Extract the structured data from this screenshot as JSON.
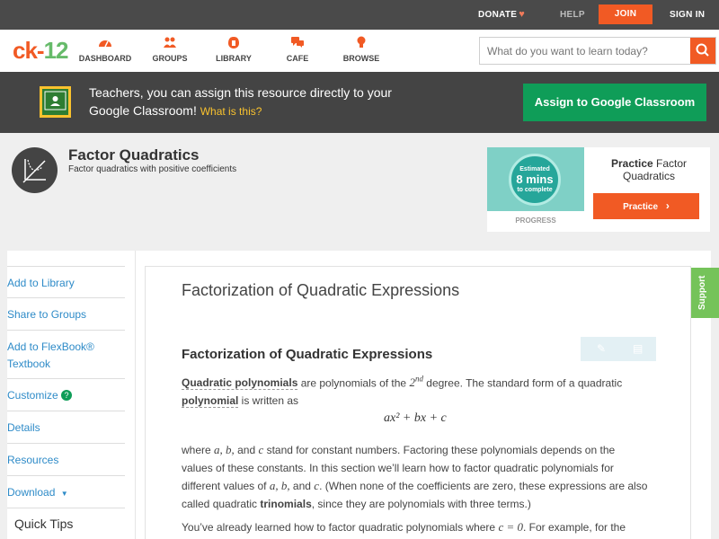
{
  "topbar": {
    "donate": "DONATE",
    "help": "HELP",
    "join": "JOIN",
    "signin": "SIGN IN"
  },
  "nav": {
    "logo_ck": "ck",
    "logo_dash": "-",
    "logo_num": "12",
    "items": [
      {
        "label": "DASHBOARD",
        "icon": "dashboard-icon"
      },
      {
        "label": "GROUPS",
        "icon": "groups-icon"
      },
      {
        "label": "LIBRARY",
        "icon": "library-icon"
      },
      {
        "label": "CAFE",
        "icon": "cafe-icon"
      },
      {
        "label": "BROWSE",
        "icon": "browse-icon"
      }
    ],
    "search_placeholder": "What do you want to learn today?"
  },
  "classroom_banner": {
    "text": "Teachers, you can assign this resource directly to your Google Classroom!",
    "what_link": "What is this?",
    "button": "Assign to Google Classroom"
  },
  "concept": {
    "title": "Factor Quadratics",
    "subtitle": "Factor quadratics with positive coefficients"
  },
  "practice_card": {
    "estimated": "Estimated",
    "mins": "8 mins",
    "to_complete": "to complete",
    "progress_label": "PROGRESS",
    "title_bold": "Practice",
    "title_rest": "Factor Quadratics",
    "button": "Practice"
  },
  "sidebar": {
    "items": [
      {
        "label": "Add to Library"
      },
      {
        "label": "Share to Groups"
      },
      {
        "label": "Add to FlexBook® Textbook"
      },
      {
        "label": "Customize"
      },
      {
        "label": "Details"
      },
      {
        "label": "Resources"
      },
      {
        "label": "Download"
      }
    ],
    "quick_tips": "Quick Tips"
  },
  "content": {
    "page_title": "Factorization of Quadratic Expressions",
    "heading": "Factorization of Quadratic Expressions",
    "p1_term1": "Quadratic polynomials",
    "p1_text1": " are polynomials of the ",
    "p1_deg": "2",
    "p1_sup": "nd",
    "p1_text2": " degree. The standard form of a quadratic ",
    "p1_term2": "polynomial",
    "p1_text3": " is written as",
    "formula": "ax² + bx + c",
    "p2_text1": "where ",
    "p2_vars1": "a, b,",
    "p2_and": " and ",
    "p2_c": "c",
    "p2_text2": " stand for constant numbers. Factoring these polynomials depends on the values of these constants. In this section we’ll learn how to factor quadratic polynomials for different values of ",
    "p2_vars2": "a, b,",
    "p2_and2": " and ",
    "p2_c2": "c",
    "p2_text3": ". (When none of the coefficients are zero, these expressions are also called quadratic ",
    "p2_bold": "trinomials",
    "p2_text4": ", since they are polynomials with three terms.)",
    "p3_text1": "You’ve already learned how to factor quadratic polynomials where ",
    "p3_math": "c = 0",
    "p3_text2": ". For example, for the"
  },
  "support": "Support",
  "colors": {
    "accent": "#f15a24",
    "google_green": "#0f9d58",
    "link": "#2e8bc8",
    "support_green": "#75c35a"
  }
}
